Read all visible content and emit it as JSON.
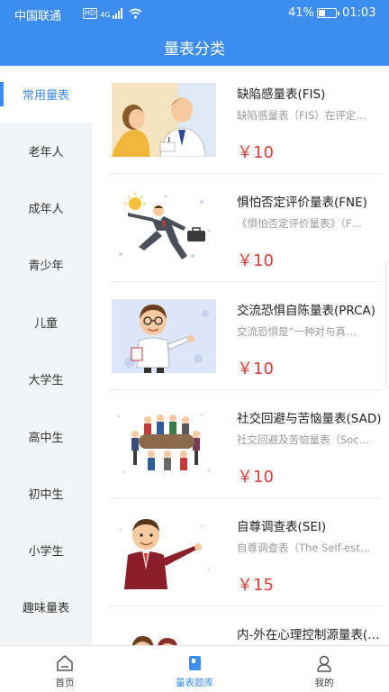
{
  "status_bar": {
    "carrier": "中国联通",
    "network_badge": "HD",
    "network_type": "4G",
    "battery_pct": "41%",
    "battery_level": 0.41,
    "time": "01:03"
  },
  "header": {
    "title": "量表分类"
  },
  "sidebar": {
    "items": [
      {
        "label": "常用量表",
        "active": true
      },
      {
        "label": "老年人"
      },
      {
        "label": "成年人"
      },
      {
        "label": "青少年"
      },
      {
        "label": "儿童"
      },
      {
        "label": "大学生"
      },
      {
        "label": "高中生"
      },
      {
        "label": "初中生"
      },
      {
        "label": "小学生"
      },
      {
        "label": "趣味量表"
      }
    ]
  },
  "scales": [
    {
      "title": "缺陷感量表(FIS)",
      "desc": "缺陷感量表（FIS）在评定…",
      "price": "￥10",
      "image": "doctor-patient-illustration"
    },
    {
      "title": "惧怕否定评价量表(FNE)",
      "desc": "《惧怕否定评价量表》（F…",
      "price": "￥10",
      "image": "running-businessman-illustration"
    },
    {
      "title": "交流恐惧自陈量表(PRCA)",
      "desc": "交流恐惧是“一种对与真…",
      "price": "￥10",
      "image": "cartoon-doctor-illustration"
    },
    {
      "title": "社交回避与苦恼量表(SAD)",
      "desc": "社交回避及苦恼量表（Soc…",
      "price": "￥10",
      "image": "meeting-table-illustration"
    },
    {
      "title": "自尊调查表(SEI)",
      "desc": "自尊调查表（The Self-est…",
      "price": "￥15",
      "image": "businessman-pointing-illustration"
    },
    {
      "title": "内-外在心理控制源量表(…",
      "desc": "",
      "price": "",
      "image": "couple-illustration"
    }
  ],
  "bottom_nav": [
    {
      "label": "首页",
      "icon": "home-icon"
    },
    {
      "label": "量表题库",
      "icon": "book-icon",
      "active": true
    },
    {
      "label": "我的",
      "icon": "user-icon"
    }
  ],
  "colors": {
    "primary": "#3d8df0",
    "price": "#d8413a",
    "sidebar_bg": "#f3f4f6"
  }
}
